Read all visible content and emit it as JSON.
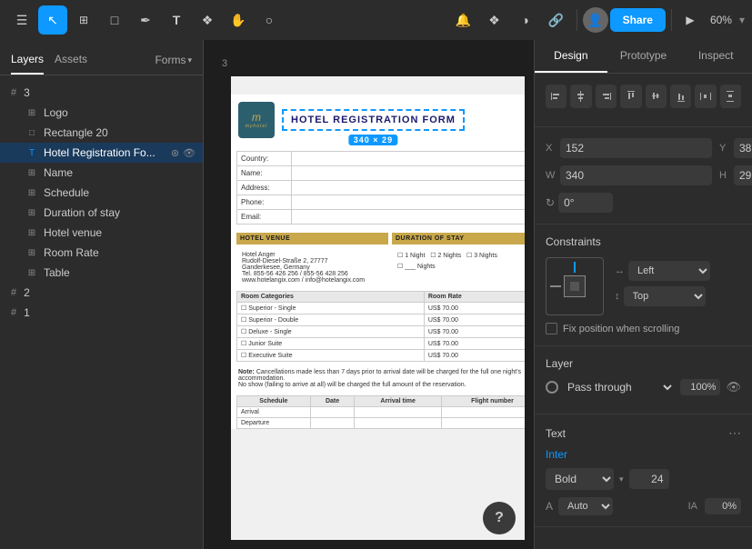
{
  "toolbar": {
    "tools": [
      {
        "name": "menu",
        "icon": "☰",
        "active": false
      },
      {
        "name": "select",
        "icon": "▲",
        "active": true
      },
      {
        "name": "frame",
        "icon": "⊞",
        "active": false
      },
      {
        "name": "shape",
        "icon": "□",
        "active": false
      },
      {
        "name": "pen",
        "icon": "✒",
        "active": false
      },
      {
        "name": "text",
        "icon": "T",
        "active": false
      },
      {
        "name": "component",
        "icon": "❖",
        "active": false
      },
      {
        "name": "hand",
        "icon": "✋",
        "active": false
      },
      {
        "name": "comment",
        "icon": "○",
        "active": false
      }
    ],
    "right_tools": [
      {
        "name": "notification",
        "icon": "🔔"
      },
      {
        "name": "plugin",
        "icon": "❖"
      },
      {
        "name": "contrast",
        "icon": "◑"
      },
      {
        "name": "link",
        "icon": "🔗"
      }
    ],
    "share_label": "Share",
    "zoom_label": "60%"
  },
  "left_panel": {
    "tabs": [
      "Layers",
      "Assets"
    ],
    "forms_tab": "Forms",
    "layers": [
      {
        "id": "3",
        "type": "hash",
        "name": "3",
        "children": []
      },
      {
        "id": "logo",
        "type": "grid",
        "name": "Logo",
        "indent": 1
      },
      {
        "id": "rect20",
        "type": "rect",
        "name": "Rectangle 20",
        "indent": 1
      },
      {
        "id": "hotelreg",
        "type": "text",
        "name": "Hotel Registration Fo...",
        "indent": 1,
        "selected": true,
        "has_actions": true
      },
      {
        "id": "name",
        "type": "grid",
        "name": "Name",
        "indent": 1
      },
      {
        "id": "schedule",
        "type": "grid",
        "name": "Schedule",
        "indent": 1
      },
      {
        "id": "duration",
        "type": "grid",
        "name": "Duration of stay",
        "indent": 1
      },
      {
        "id": "venue",
        "type": "grid",
        "name": "Hotel venue",
        "indent": 1
      },
      {
        "id": "roomrate",
        "type": "grid",
        "name": "Room Rate",
        "indent": 1
      },
      {
        "id": "table",
        "type": "grid",
        "name": "Table",
        "indent": 1
      },
      {
        "id": "2",
        "type": "hash",
        "name": "2",
        "children": []
      },
      {
        "id": "1",
        "type": "hash",
        "name": "1",
        "children": []
      }
    ]
  },
  "canvas": {
    "label": "3",
    "form": {
      "title": "HOTEL REGISTRATION FORM",
      "size_badge": "340 × 29",
      "logo_text": "m",
      "logo_subtext": "myhotel",
      "fields": [
        {
          "label": "Country:",
          "value": ""
        },
        {
          "label": "Name:",
          "value": ""
        },
        {
          "label": "Address:",
          "value": ""
        },
        {
          "label": "Phone:",
          "value": ""
        },
        {
          "label": "Email:",
          "value": ""
        }
      ],
      "hotel_venue_label": "HOTEL VENUE",
      "duration_label": "DURATION OF STAY",
      "venue_info": "Hotel Anger\nRudolf-Diesel-Straße 2, 27777\nGanderkesee, Germany\nTel. 855-56 426 256 / 855-56 428 256\nwww.hotelangix.com / info@hotelangix.com",
      "stay_options": [
        "1 Night",
        "2 Nights",
        "3 Nights",
        "___ Nights"
      ],
      "room_categories_label": "Room Categories",
      "room_rate_label": "Room Rate",
      "rooms": [
        {
          "name": "Superior - Single",
          "rate": "US$ 70.00"
        },
        {
          "name": "Superior - Double",
          "rate": "US$ 70.00"
        },
        {
          "name": "Deluxe - Single",
          "rate": "US$ 70.00"
        },
        {
          "name": "Junior Suite",
          "rate": "US$ 70.00"
        },
        {
          "name": "Executive Suite",
          "rate": "US$ 70.00"
        }
      ],
      "note": "Note: Cancellations made less than 7 days prior to arrival date will be charged for the full one night's accommodation.\nNo show (failing to arrive at all) will be charged the full amount of the reservation.",
      "schedule_cols": [
        "Schedule",
        "Date",
        "Arrival time",
        "Flight number"
      ],
      "schedule_rows": [
        "Arrival",
        "Departure"
      ]
    }
  },
  "right_panel": {
    "tabs": [
      "Design",
      "Prototype",
      "Inspect"
    ],
    "design": {
      "alignment": {
        "buttons": [
          "⬛",
          "⬛",
          "⬛",
          "⬛",
          "⬛",
          "⬛",
          "⬛",
          "⬛"
        ]
      },
      "position": {
        "x_label": "X",
        "x_value": "152",
        "y_label": "Y",
        "y_value": "38",
        "w_label": "W",
        "w_value": "340",
        "h_label": "H",
        "h_value": "29",
        "rotate_value": "0°"
      },
      "constraints": {
        "title": "Constraints",
        "horizontal_label": "Left",
        "vertical_label": "Top",
        "fix_scroll_label": "Fix position when scrolling"
      },
      "layer": {
        "title": "Layer",
        "blend_mode": "Pass through",
        "opacity": "100%",
        "visible": true
      },
      "text": {
        "title": "Text",
        "font_name": "Inter",
        "font_weight": "Bold",
        "font_size": "24",
        "auto_label": "A",
        "auto_value": "Auto",
        "letter_spacing_label": "IA",
        "letter_spacing": "0%"
      }
    }
  },
  "help_btn": "?"
}
